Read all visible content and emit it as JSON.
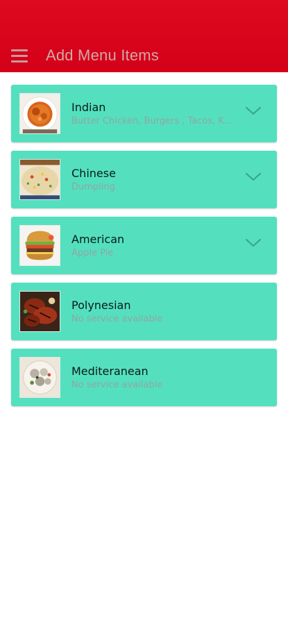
{
  "header": {
    "title": "Add Menu Items",
    "menu_icon": "hamburger-menu-icon",
    "background": "#d90b1d"
  },
  "card_color": "#54e0bf",
  "categories": [
    {
      "name": "Indian",
      "subtitle": "Butter Chicken, Burgers , Tacos, K...",
      "expandable": true,
      "thumbnail": "curry-bowl-image"
    },
    {
      "name": "Chinese",
      "subtitle": "Dumpling",
      "expandable": true,
      "thumbnail": "fried-rice-image"
    },
    {
      "name": "American",
      "subtitle": "Apple Pie",
      "expandable": true,
      "thumbnail": "burger-image"
    },
    {
      "name": "Polynesian",
      "subtitle": "No service available",
      "expandable": false,
      "thumbnail": "grilled-meat-image"
    },
    {
      "name": "Mediteranean",
      "subtitle": "No service available",
      "expandable": false,
      "thumbnail": "mezze-plate-image"
    }
  ]
}
